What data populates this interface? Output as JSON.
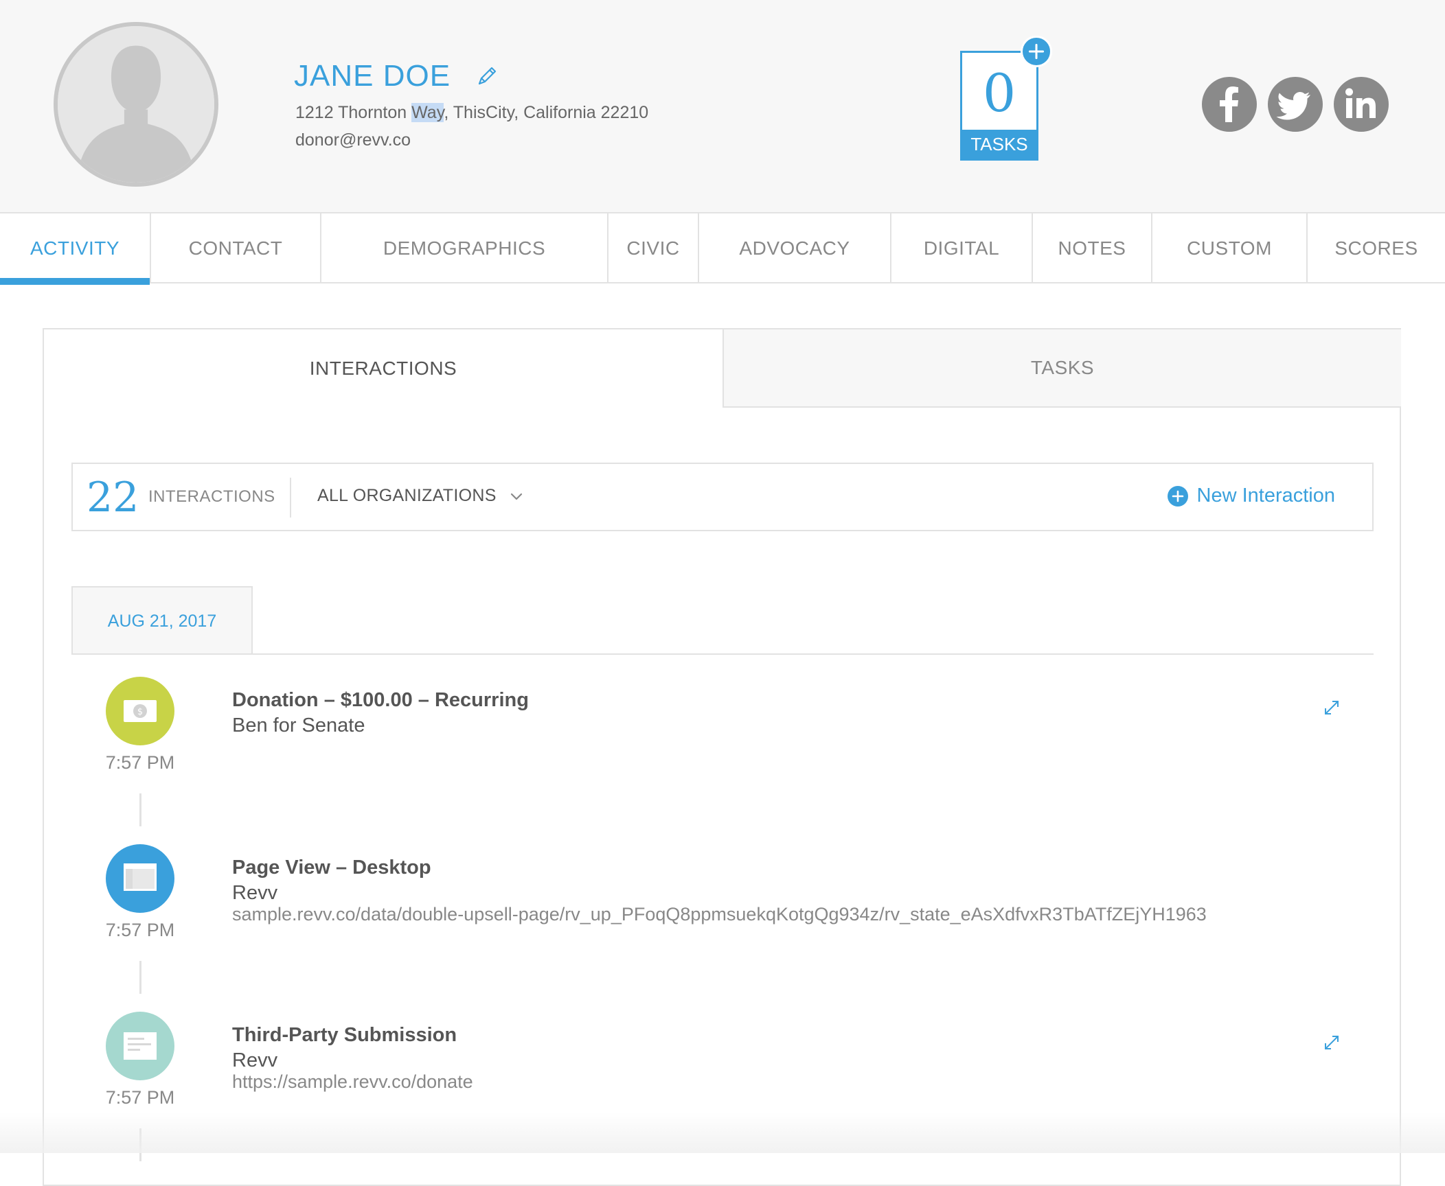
{
  "profile": {
    "name": "JANE DOE",
    "address_before": "1212 Thornton ",
    "address_highlight": "Way",
    "address_after": ", ThisCity, California 22210",
    "email": "donor@revv.co"
  },
  "tasks_widget": {
    "count": "0",
    "label": "TASKS"
  },
  "social": [
    "facebook",
    "twitter",
    "linkedin"
  ],
  "main_tabs": [
    {
      "label": "ACTIVITY",
      "active": true
    },
    {
      "label": "CONTACT"
    },
    {
      "label": "DEMOGRAPHICS"
    },
    {
      "label": "CIVIC"
    },
    {
      "label": "ADVOCACY"
    },
    {
      "label": "DIGITAL"
    },
    {
      "label": "NOTES"
    },
    {
      "label": "CUSTOM"
    },
    {
      "label": "SCORES"
    }
  ],
  "sub_tabs": {
    "interactions": "INTERACTIONS",
    "tasks": "TASKS",
    "active": "interactions"
  },
  "filter_bar": {
    "count": "22",
    "count_label": "INTERACTIONS",
    "org_select": "ALL ORGANIZATIONS",
    "new_interaction": "New Interaction"
  },
  "date_group": "AUG 21, 2017",
  "interactions": [
    {
      "title": "Donation – $100.00 – Recurring",
      "org": "Ben for Senate",
      "url": "",
      "time": "7:57 PM",
      "icon": "money-icon",
      "color": "#c8d347"
    },
    {
      "title": "Page View – Desktop",
      "org": "Revv",
      "url": "sample.revv.co/data/double-upsell-page/rv_up_PFoqQ8ppmsuekqKotgQg934z/rv_state_eAsXdfvxR3TbATfZEjYH1963",
      "time": "7:57 PM",
      "icon": "browser-icon",
      "color": "#3aa0dc"
    },
    {
      "title": "Third-Party Submission",
      "org": "Revv",
      "url": "https://sample.revv.co/donate",
      "time": "7:57 PM",
      "icon": "form-icon",
      "color": "#a5d8cf"
    }
  ],
  "colors": {
    "accent": "#3aa0dc",
    "social_gray": "#8a8a8a",
    "border": "#e2e2e2"
  }
}
